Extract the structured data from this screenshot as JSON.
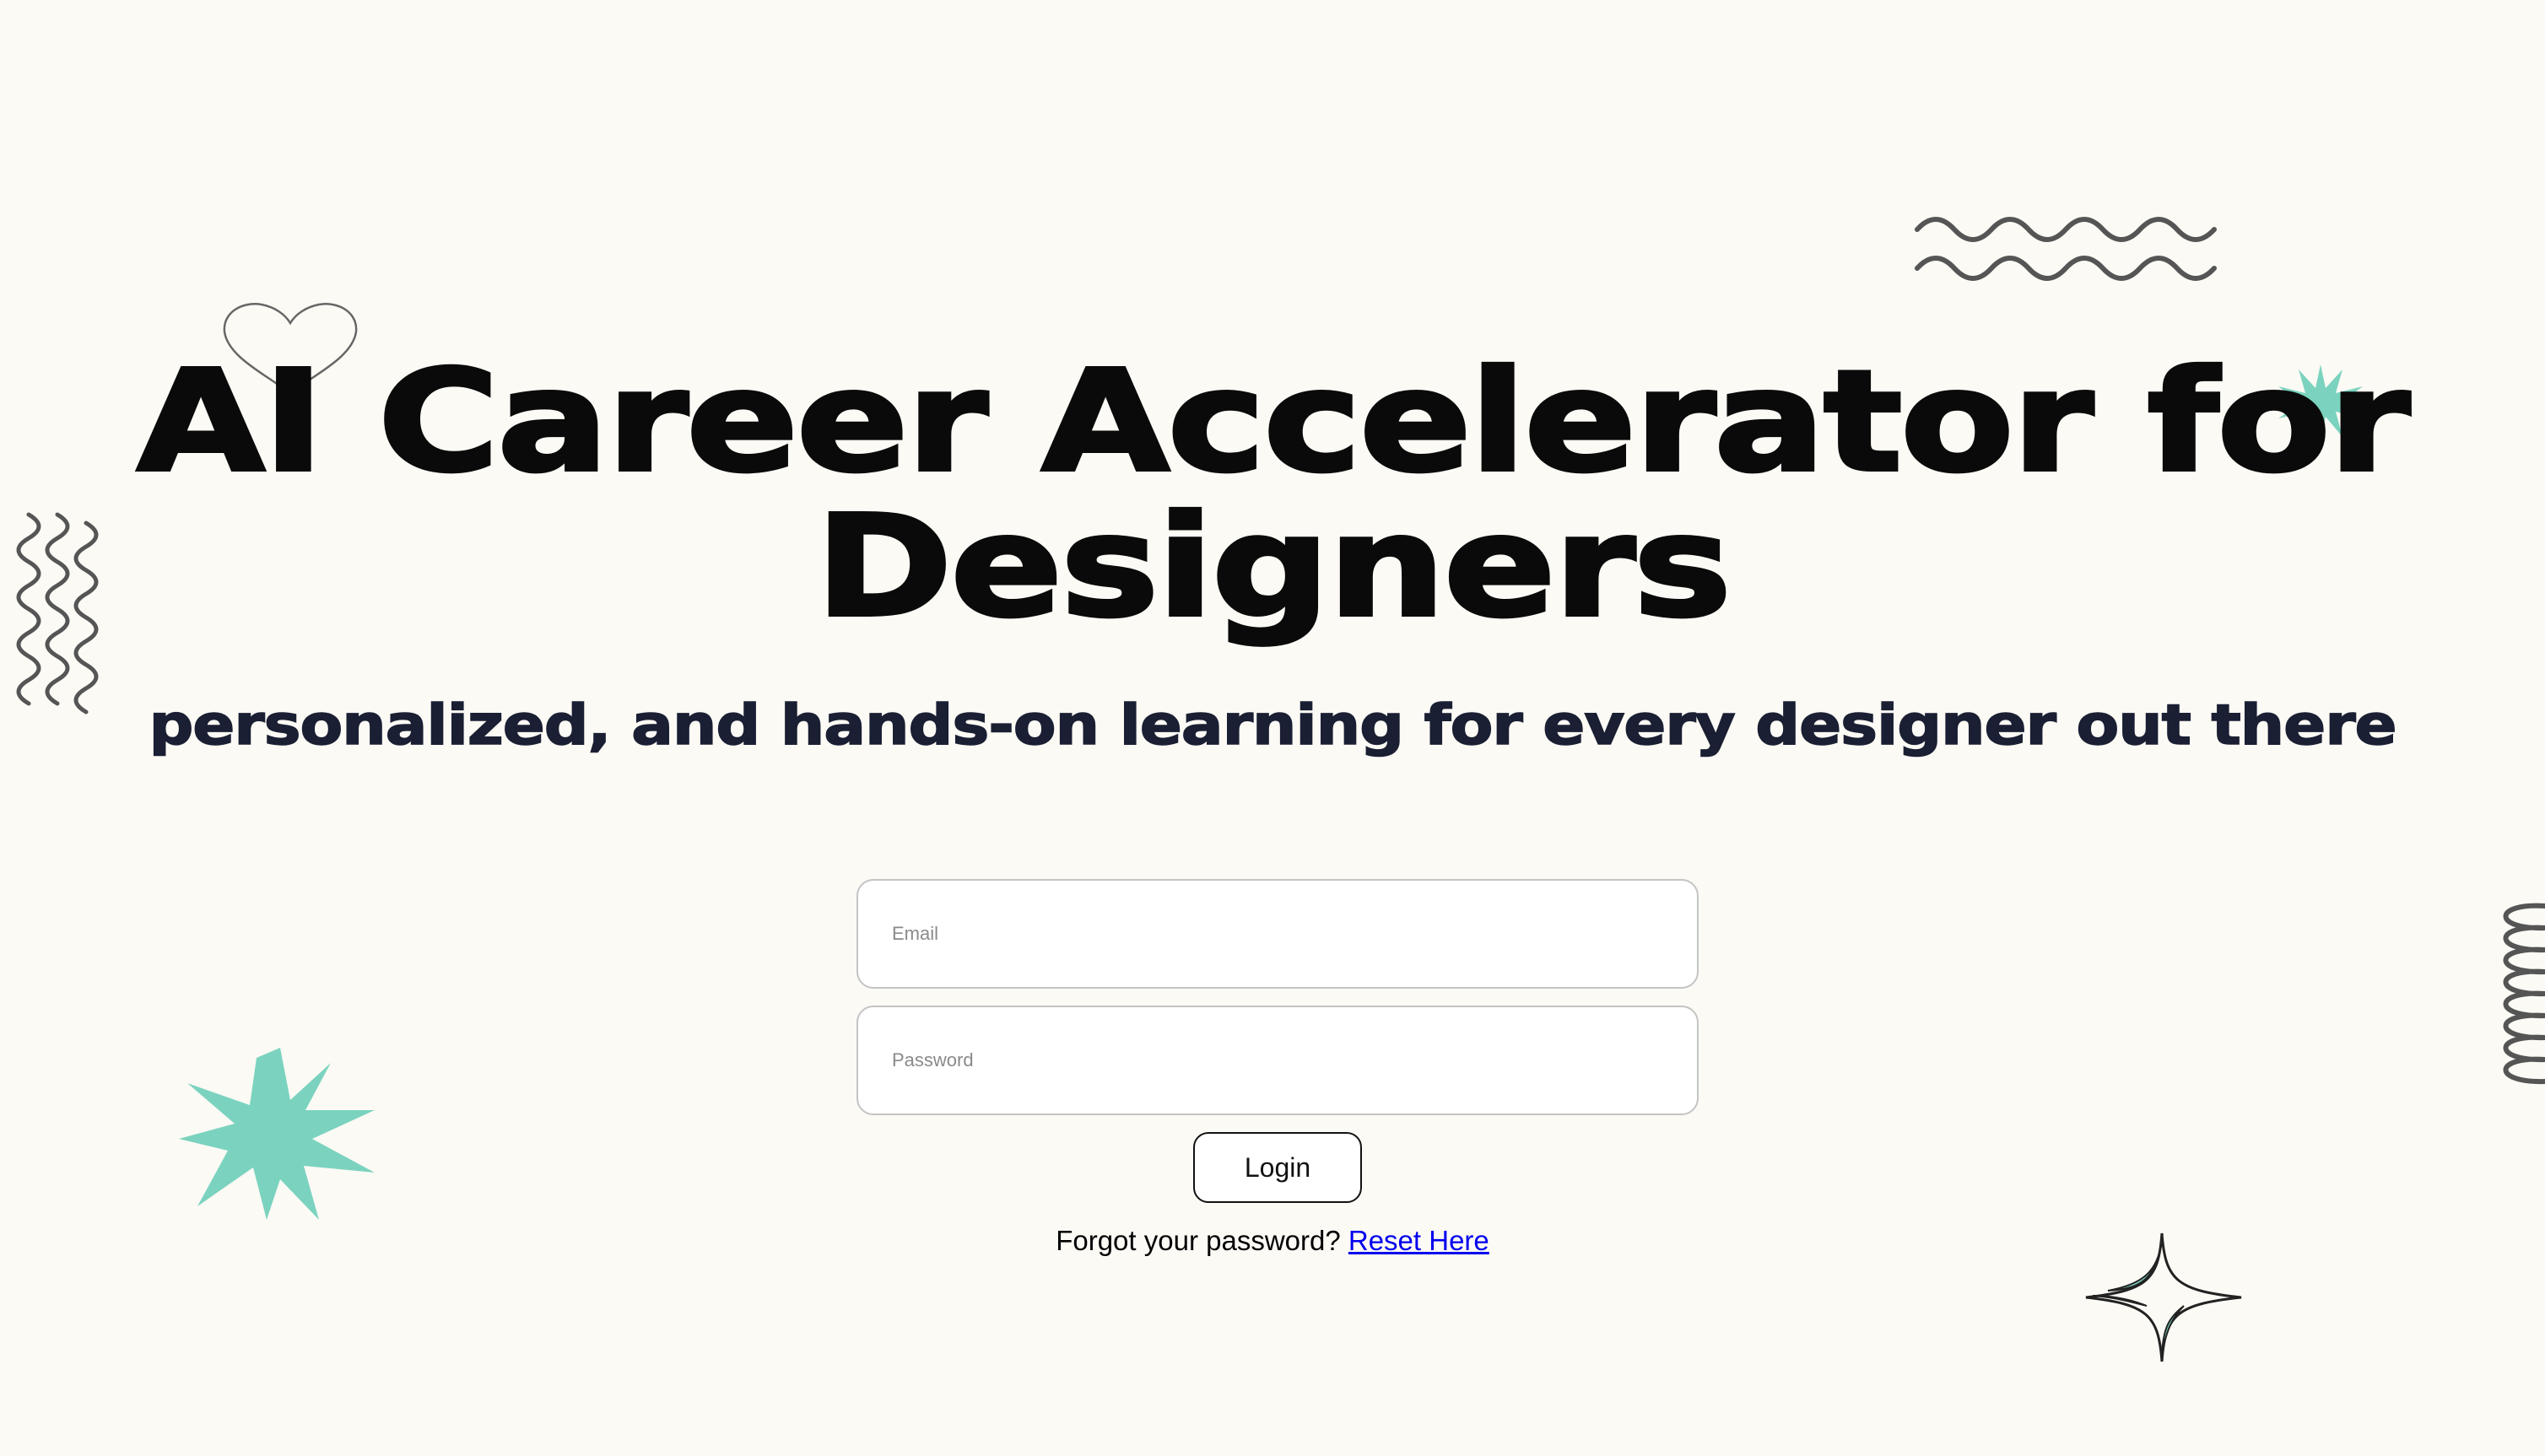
{
  "hero": {
    "title": "AI Career Accelerator for Designers",
    "subtitle": "personalized, and hands-on learning for every designer out there"
  },
  "login_form": {
    "email_placeholder": "Email",
    "password_placeholder": "Password",
    "login_label": "Login",
    "forgot_text": "Forgot your password?",
    "reset_link": "Reset Here"
  },
  "decorations": {
    "icons": [
      "heart-outline-icon",
      "zigzag-lines-icon",
      "small-starburst-icon",
      "vertical-wave-lines-icon",
      "large-starburst-icon",
      "coil-spring-icon",
      "sparkle-star-icon"
    ],
    "accent_color": "#7bd3bf",
    "line_color": "#555555"
  },
  "colors": {
    "background": "#fcfaf5",
    "title": "#0a0a0a",
    "subtitle": "#1a1f33",
    "link": "#0000ee"
  }
}
